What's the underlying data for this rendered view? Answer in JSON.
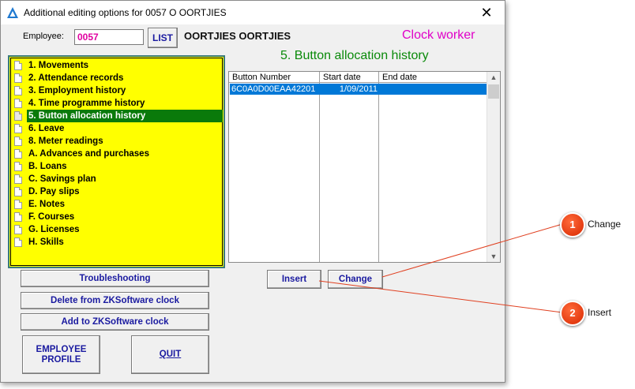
{
  "window": {
    "title": "Additional editing options for 0057 O OORTJIES",
    "close_glyph": "✕"
  },
  "employee": {
    "label": "Employee:",
    "value": "0057",
    "list_button": "LIST",
    "name": "OORTJIES OORTJIES",
    "role": "Clock worker"
  },
  "section_title": "5. Button allocation history",
  "menu": {
    "items": [
      {
        "label": "1. Movements",
        "selected": false
      },
      {
        "label": "2. Attendance records",
        "selected": false
      },
      {
        "label": "3. Employment history",
        "selected": false
      },
      {
        "label": "4. Time programme history",
        "selected": false
      },
      {
        "label": "5. Button allocation history",
        "selected": true
      },
      {
        "label": "6. Leave",
        "selected": false
      },
      {
        "label": "8. Meter readings",
        "selected": false
      },
      {
        "label": "A. Advances and purchases",
        "selected": false
      },
      {
        "label": "B. Loans",
        "selected": false
      },
      {
        "label": "C. Savings plan",
        "selected": false
      },
      {
        "label": "D. Pay slips",
        "selected": false
      },
      {
        "label": "E. Notes",
        "selected": false
      },
      {
        "label": "F. Courses",
        "selected": false
      },
      {
        "label": "G. Licenses",
        "selected": false
      },
      {
        "label": "H. Skills",
        "selected": false
      }
    ]
  },
  "grid": {
    "columns": [
      "Button Number",
      "Start date",
      "End date"
    ],
    "rows": [
      {
        "button_number": "6C0A0D00EAA42201",
        "start_date": "1/09/2011",
        "end_date": ""
      }
    ]
  },
  "buttons": {
    "troubleshooting": "Troubleshooting",
    "delete_zk": "Delete from ZKSoftware clock",
    "add_zk": "Add to ZKSoftware clock",
    "profile_line1": "EMPLOYEE",
    "profile_line2": "PROFILE",
    "quit": "QUIT",
    "insert": "Insert",
    "change": "Change"
  },
  "callouts": [
    {
      "number": "1",
      "label": "Change"
    },
    {
      "number": "2",
      "label": "Insert"
    }
  ],
  "colors": {
    "accent_menu_bg": "#ffff00",
    "selected_menu": "#0a7a0a",
    "selected_row": "#0078d7",
    "section_title": "#0a8a0a",
    "role_text": "#e000c8",
    "badge": "#e03a10"
  }
}
